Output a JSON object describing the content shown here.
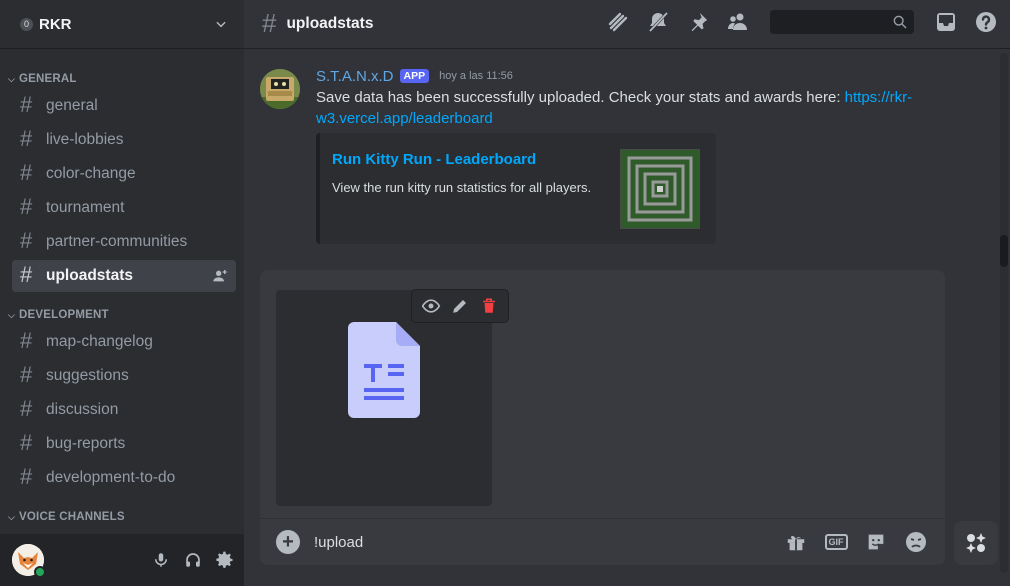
{
  "server": {
    "badge": "0",
    "name": "RKR"
  },
  "categories": {
    "general": "GENERAL",
    "development": "DEVELOPMENT",
    "voice": "VOICE CHANNELS"
  },
  "channels": {
    "general": [
      "general",
      "live-lobbies",
      "color-change",
      "tournament",
      "partner-communities",
      "uploadstats"
    ],
    "development": [
      "map-changelog",
      "suggestions",
      "discussion",
      "bug-reports",
      "development-to-do"
    ]
  },
  "active_channel": "uploadstats",
  "header": {
    "title": "uploadstats",
    "search_placeholder": ""
  },
  "message": {
    "author": "S.T.A.N.x.D",
    "tag": "APP",
    "timestamp": "hoy a las 11:56",
    "text": "Save data has been successfully uploaded. Check your stats and awards here: ",
    "link": "https://rkr-w3.vercel.app/leaderboard",
    "embed": {
      "title": "Run Kitty Run - Leaderboard",
      "description": "View the run kitty run statistics for all players."
    }
  },
  "composer": {
    "value": "!upload",
    "gif_label": "GIF"
  },
  "colors": {
    "accent": "#5865f2",
    "link": "#00a8fc",
    "online": "#23a55a",
    "danger": "#f23f42"
  }
}
